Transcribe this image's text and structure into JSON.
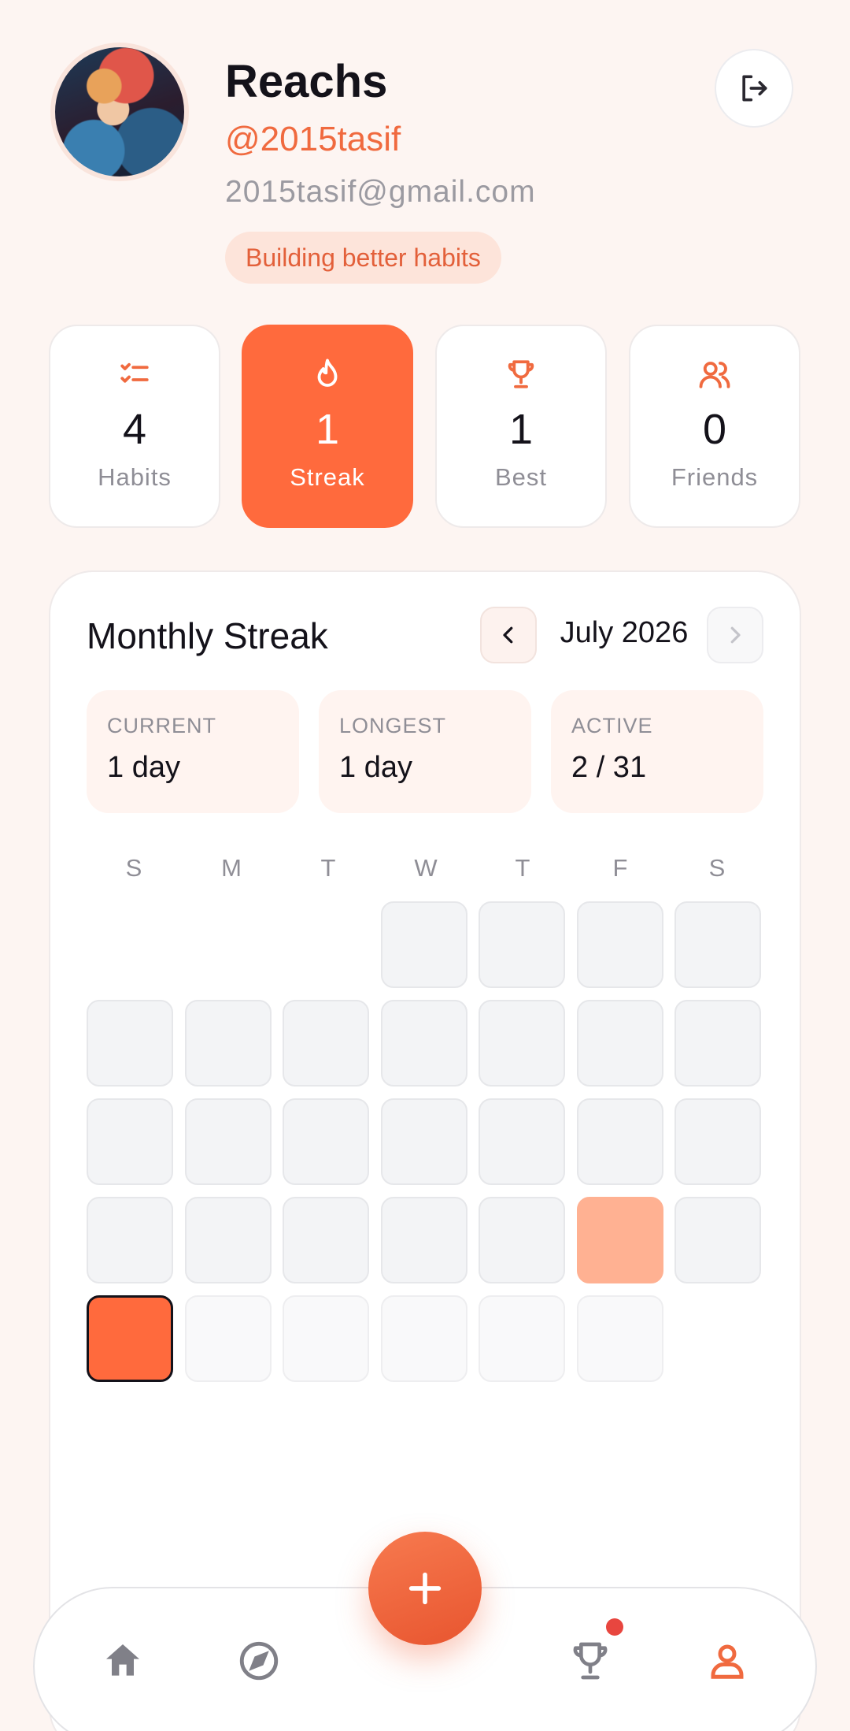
{
  "profile": {
    "name": "Reachs",
    "handle": "@2015tasif",
    "email": "2015tasif@gmail.com",
    "bio": "Building better habits"
  },
  "stats": [
    {
      "value": "4",
      "label": "Habits",
      "icon": "checklist-icon"
    },
    {
      "value": "1",
      "label": "Streak",
      "icon": "flame-icon"
    },
    {
      "value": "1",
      "label": "Best",
      "icon": "trophy-icon"
    },
    {
      "value": "0",
      "label": "Friends",
      "icon": "friends-icon"
    }
  ],
  "streak_card": {
    "title": "Monthly Streak",
    "month": "July 2026",
    "summary": [
      {
        "label": "CURRENT",
        "value": "1 day"
      },
      {
        "label": "LONGEST",
        "value": "1 day"
      },
      {
        "label": "ACTIVE",
        "value": "2 / 31"
      }
    ],
    "weekdays": [
      "S",
      "M",
      "T",
      "W",
      "T",
      "F",
      "S"
    ],
    "days_in_month": 31,
    "first_weekday_index": 3,
    "active_days": [
      24
    ],
    "today": 26,
    "colors": {
      "active_day": "#ffb192",
      "today": "#ff6a3d"
    }
  },
  "nav": {
    "items": [
      "home-icon",
      "compass-icon",
      "trophy-icon",
      "profile-icon"
    ],
    "active": "profile-icon",
    "fab_icon": "plus-icon"
  },
  "theme": {
    "accent": "#ff6a3d",
    "background": "#fdf5f2"
  }
}
